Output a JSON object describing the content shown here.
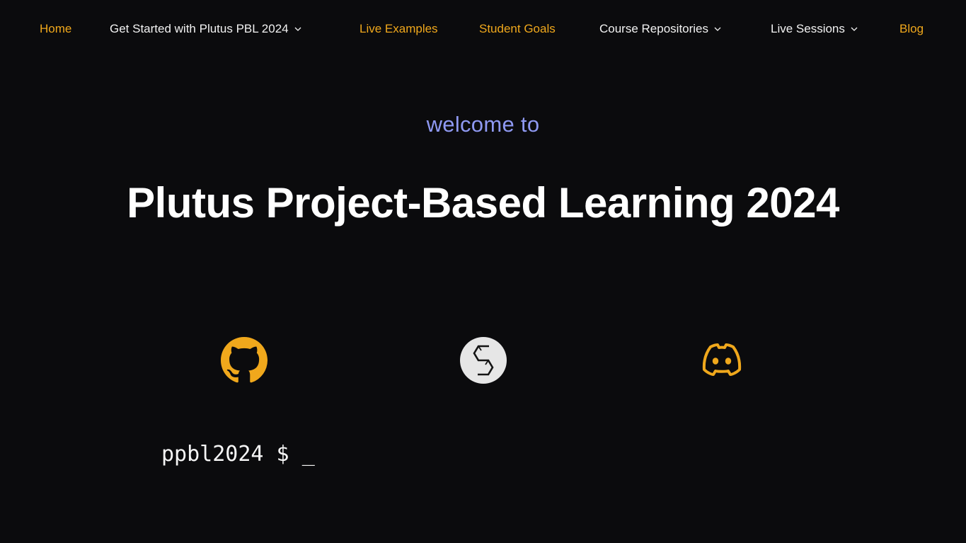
{
  "nav": {
    "items": [
      {
        "label": "Home",
        "dropdown": false,
        "color": "#f0a81c"
      },
      {
        "label": "Get Started with Plutus PBL 2024",
        "dropdown": true,
        "color": "#f2f2f2"
      },
      {
        "label": "Live Examples",
        "dropdown": false,
        "color": "#f0a81c"
      },
      {
        "label": "Student Goals",
        "dropdown": false,
        "color": "#f0a81c"
      },
      {
        "label": "Course Repositories",
        "dropdown": true,
        "color": "#f2f2f2"
      },
      {
        "label": "Live Sessions",
        "dropdown": true,
        "color": "#f2f2f2"
      },
      {
        "label": "Blog",
        "dropdown": false,
        "color": "#f0a81c"
      }
    ]
  },
  "hero": {
    "subtitle": "welcome to",
    "title": "Plutus Project-Based Learning 2024"
  },
  "social": {
    "github": {
      "icon": "github-icon",
      "color": "#f0a81c"
    },
    "gimbalabs": {
      "icon": "gimbalabs-logo-icon",
      "color": "#e6e6e6"
    },
    "discord": {
      "icon": "discord-icon",
      "color": "#f0a81c"
    }
  },
  "terminal": {
    "prompt": "ppbl2024 $ ",
    "cursor": "_"
  },
  "colors": {
    "background": "#0b0b0d",
    "accent": "#f0a81c",
    "subtitle": "#8f99f2"
  }
}
